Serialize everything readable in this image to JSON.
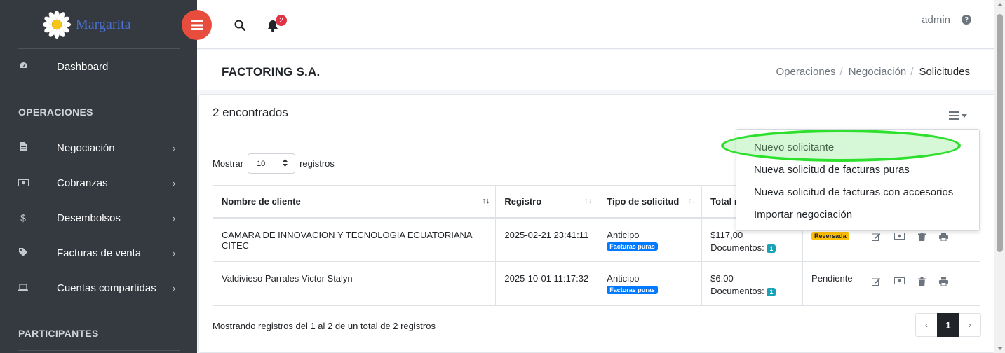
{
  "brand": {
    "name": "Margarita"
  },
  "sidebar": {
    "dashboard": {
      "label": "Dashboard",
      "icon": "tachometer-icon"
    },
    "section_operaciones": "OPERACIONES",
    "items": [
      {
        "label": "Negociación",
        "icon": "file-icon"
      },
      {
        "label": "Cobranzas",
        "icon": "money-bill-icon"
      },
      {
        "label": "Desembolsos",
        "icon": "dollar-icon"
      },
      {
        "label": "Facturas de venta",
        "icon": "tag-icon"
      },
      {
        "label": "Cuentas compartidas",
        "icon": "laptop-icon"
      }
    ],
    "section_participantes": "PARTICIPANTES",
    "chevron": "›"
  },
  "topbar": {
    "notifications_count": "2",
    "user": "admin",
    "help": "?"
  },
  "header": {
    "title": "FACTORING S.A.",
    "breadcrumb": [
      "Operaciones",
      "Negociación",
      "Solicitudes"
    ],
    "separator": "/"
  },
  "card": {
    "found": "2 encontrados",
    "length": {
      "prefix": "Mostrar",
      "value": "10",
      "suffix": "registros"
    },
    "columns": [
      "Nombre de cliente",
      "Registro",
      "Tipo de solicitud",
      "Total n",
      "",
      ""
    ],
    "rows": [
      {
        "cliente": "CAMARA DE INNOVACION Y TECNOLOGIA ECUATORIANA CITEC",
        "registro": "2025-02-21 23:41:11",
        "tipo": "Anticipo",
        "tipo_badge": "Facturas puras",
        "total": "$117,00",
        "docs_label": "Documentos:",
        "docs_count": "1",
        "estado": "Reversada"
      },
      {
        "cliente": "Valdivieso Parrales Victor Stalyn",
        "registro": "2025-10-01 11:17:32",
        "tipo": "Anticipo",
        "tipo_badge": "Facturas puras",
        "total": "$6,00",
        "docs_label": "Documentos:",
        "docs_count": "1",
        "estado": "Pendiente"
      }
    ],
    "info": "Mostrando registros del 1 al 2 de un total de 2 registros",
    "pagination": {
      "prev": "‹",
      "current": "1",
      "next": "›"
    }
  },
  "dropdown": {
    "items": [
      "Nuevo solicitante",
      "Nueva solicitud de facturas puras",
      "Nueva solicitud de facturas con accesorios",
      "Importar negociación"
    ]
  },
  "colors": {
    "sidebar_bg": "#343a40",
    "accent_red": "#e74c3c",
    "highlight_green": "#2ee02e",
    "badge_blue": "#007bff",
    "badge_teal": "#17a2b8",
    "badge_yellow": "#ffc107"
  }
}
